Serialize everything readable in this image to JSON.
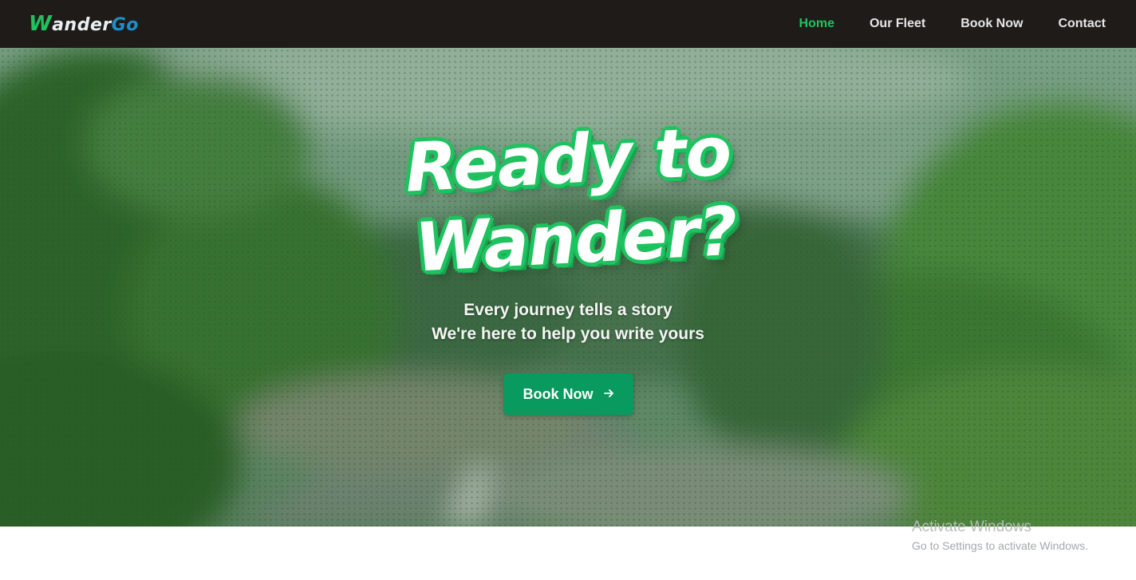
{
  "navbar": {
    "logo": {
      "part1": "W",
      "part2": "ander",
      "part3": "Go"
    },
    "links": [
      {
        "label": "Home",
        "active": true
      },
      {
        "label": "Our Fleet",
        "active": false
      },
      {
        "label": "Book Now",
        "active": false
      },
      {
        "label": "Contact",
        "active": false
      }
    ]
  },
  "hero": {
    "headline_line1": "Ready to",
    "headline_line2": "Wander?",
    "subtitle_line1": "Every journey tells a story",
    "subtitle_line2": "We're here to help you write yours",
    "cta_label": "Book Now",
    "cta_icon": "arrow-right-icon"
  },
  "watermark": {
    "title": "Activate Windows",
    "subtitle": "Go to Settings to activate Windows."
  },
  "colors": {
    "navbar_bg": "#1f1b19",
    "accent_green": "#1ec25f",
    "logo_blue": "#1d8fc9",
    "button_bg": "#089a5e"
  }
}
